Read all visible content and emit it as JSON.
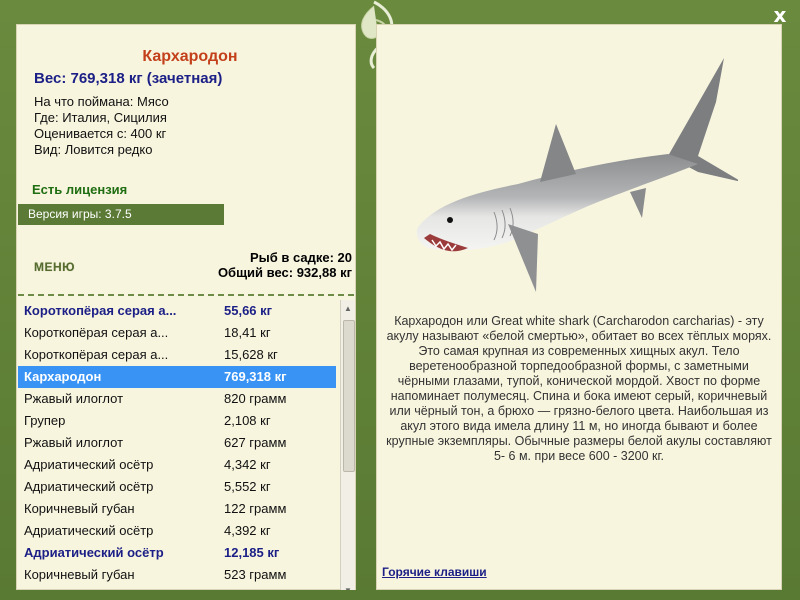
{
  "colors": {
    "frame": "#5e7e36",
    "panel": "#f8f5df",
    "title": "#c3401a",
    "weight": "#1b1f86",
    "license": "#1f6e12",
    "selected_row": "#3893f5"
  },
  "header": {
    "close_label": "x",
    "close_icon": "close-icon"
  },
  "info": {
    "title": "Кархародон",
    "weight": "Вес: 769,318 кг (зачетная)",
    "caught_on": "На что поймана: Мясо",
    "where": "Где: Италия, Сицилия",
    "valued_from": "Оценивается с: 400 кг",
    "kind": "Вид: Ловится редко",
    "license": "Есть лицензия",
    "version": "Версия игры: 3.7.5"
  },
  "menu_label": "МЕНЮ",
  "cage": {
    "count": "Рыб в садке: 20",
    "total_weight": "Общий вес: 932,88 кг"
  },
  "fish_list": [
    {
      "name": "Короткопёрая серая а...",
      "weight": "55,66 кг",
      "record": true,
      "selected": false
    },
    {
      "name": "Короткопёрая серая а...",
      "weight": "18,41 кг",
      "record": false,
      "selected": false
    },
    {
      "name": "Короткопёрая серая а...",
      "weight": "15,628 кг",
      "record": false,
      "selected": false
    },
    {
      "name": "Кархародон",
      "weight": "769,318 кг",
      "record": true,
      "selected": true
    },
    {
      "name": "Ржавый илоглот",
      "weight": "820 грамм",
      "record": false,
      "selected": false
    },
    {
      "name": "Групер",
      "weight": "2,108 кг",
      "record": false,
      "selected": false
    },
    {
      "name": "Ржавый илоглот",
      "weight": "627 грамм",
      "record": false,
      "selected": false
    },
    {
      "name": "Адриатический осётр",
      "weight": "4,342 кг",
      "record": false,
      "selected": false
    },
    {
      "name": "Адриатический осётр",
      "weight": "5,552 кг",
      "record": false,
      "selected": false
    },
    {
      "name": "Коричневый губан",
      "weight": "122 грамм",
      "record": false,
      "selected": false
    },
    {
      "name": "Адриатический осётр",
      "weight": "4,392 кг",
      "record": false,
      "selected": false
    },
    {
      "name": "Адриатический осётр",
      "weight": "12,185 кг",
      "record": true,
      "selected": false
    },
    {
      "name": "Коричневый губан",
      "weight": "523 грамм",
      "record": false,
      "selected": false
    }
  ],
  "description": "Кархародон или Great white shark (Carcharodon carcharias) - эту акулу называют «белой смертью», обитает во всех тёплых морях. Это самая крупная из современных хищных акул. Тело веретенообразной торпедообразной формы, с заметными чёрными глазами, тупой, конической мордой. Хвост по форме напоминает полумесяц. Спина и бока имеют серый, коричневый или чёрный тон, а брюхо — грязно-белого цвета. Наибольшая из акул этого вида имела длину 11 м, но иногда бывают и более крупные экземпляры. Обычные размеры белой акулы составляют 5- 6 м. при весе 600 - 3200 кг.",
  "hotkeys_label": "Горячие клавиши",
  "icons": {
    "ornament": "leaf-ornament-icon",
    "shark": "shark-image",
    "scroll_up": "scroll-up-arrow-icon",
    "scroll_down": "scroll-down-arrow-icon"
  }
}
